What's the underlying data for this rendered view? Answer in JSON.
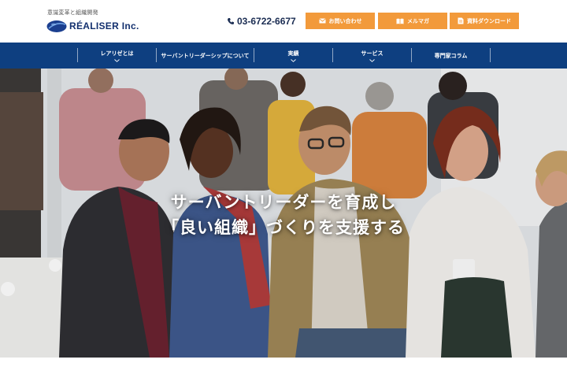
{
  "header": {
    "tagline": "意識変革と組織開発",
    "logo_text": "RÉALISER Inc.",
    "phone": "03-6722-6677",
    "buttons": {
      "contact": "お問い合わせ",
      "mailmag": "メルマガ",
      "download": "資料ダウンロード"
    }
  },
  "nav": {
    "items": [
      {
        "label": "レアリゼとは"
      },
      {
        "label": "サーバントリーダーシップについて"
      },
      {
        "label": "実績"
      },
      {
        "label": "サービス"
      },
      {
        "label": "専門家コラム"
      }
    ]
  },
  "hero": {
    "line1": "サーバントリーダーを育成し",
    "line2": "「良い組織」づくりを支援する"
  },
  "colors": {
    "brand_navy": "#0e3f80",
    "accent_orange": "#f29a3b"
  },
  "icons": [
    "phone-icon",
    "envelope-icon",
    "book-icon",
    "document-icon",
    "chevron-down-icon"
  ]
}
